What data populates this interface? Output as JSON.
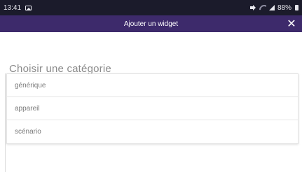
{
  "status_bar": {
    "time": "13:41",
    "battery": "88%",
    "icons": [
      "picture-icon",
      "mute-icon",
      "wifi-icon",
      "signal-icon",
      "battery-icon"
    ]
  },
  "app_bar": {
    "title": "Ajouter un widget",
    "close_label": "✕",
    "background_color": "#3d2a6b"
  },
  "main": {
    "section_title": "Choisir une catégorie",
    "categories": [
      {
        "label": "générique"
      },
      {
        "label": "appareil"
      },
      {
        "label": "scénario"
      }
    ]
  }
}
